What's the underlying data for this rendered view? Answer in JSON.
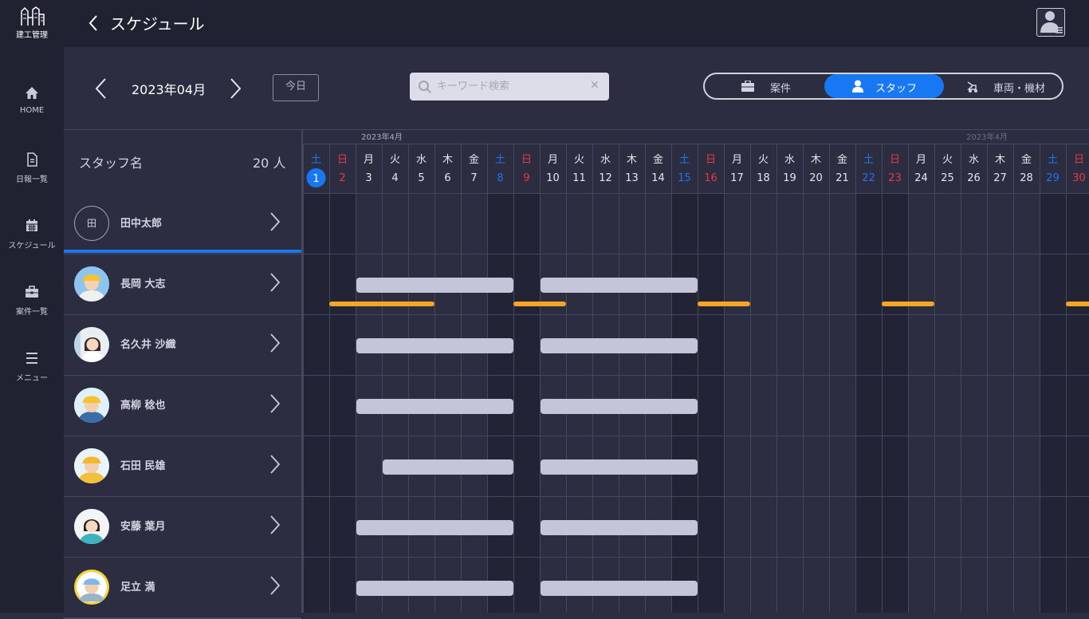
{
  "app": {
    "logo_text": "建工管理",
    "title": "スケジュール"
  },
  "sidebar": {
    "items": [
      {
        "label": "HOME",
        "icon": "home-icon"
      },
      {
        "label": "日報一覧",
        "icon": "document-icon"
      },
      {
        "label": "スケジュール",
        "icon": "calendar-icon"
      },
      {
        "label": "案件一覧",
        "icon": "briefcase-icon"
      },
      {
        "label": "メニュー",
        "icon": "menu-icon"
      }
    ]
  },
  "toolbar": {
    "month_label": "2023年04月",
    "today_label": "今日",
    "search_placeholder": "キーワード検索",
    "segments": [
      {
        "label": "案件",
        "icon": "briefcase-icon"
      },
      {
        "label": "スタッフ",
        "icon": "person-icon",
        "active": true
      },
      {
        "label": "車両・機材",
        "icon": "vehicle-icon"
      }
    ]
  },
  "staff": {
    "header_label": "スタッフ名",
    "count_label": "20 人",
    "members": [
      {
        "name": "田中太郎",
        "initial": "田"
      },
      {
        "name": "長岡 大志",
        "avatar": "worker-hardhat"
      },
      {
        "name": "名久井 沙織",
        "avatar": "office-woman"
      },
      {
        "name": "高柳 稔也",
        "avatar": "worker-hardhat"
      },
      {
        "name": "石田 民雄",
        "avatar": "worker-hardhat"
      },
      {
        "name": "安藤 葉月",
        "avatar": "woman"
      },
      {
        "name": "足立 満",
        "avatar": "worker-hardhat"
      }
    ]
  },
  "calendar": {
    "month_labels": [
      "2023年4月",
      "2023年4月"
    ],
    "today_day": 1,
    "days": [
      {
        "wd": "土",
        "d": "1"
      },
      {
        "wd": "日",
        "d": "2"
      },
      {
        "wd": "月",
        "d": "3"
      },
      {
        "wd": "火",
        "d": "4"
      },
      {
        "wd": "水",
        "d": "5"
      },
      {
        "wd": "木",
        "d": "6"
      },
      {
        "wd": "金",
        "d": "7"
      },
      {
        "wd": "土",
        "d": "8"
      },
      {
        "wd": "日",
        "d": "9"
      },
      {
        "wd": "月",
        "d": "10"
      },
      {
        "wd": "火",
        "d": "11"
      },
      {
        "wd": "水",
        "d": "12"
      },
      {
        "wd": "木",
        "d": "13"
      },
      {
        "wd": "金",
        "d": "14"
      },
      {
        "wd": "土",
        "d": "15"
      },
      {
        "wd": "日",
        "d": "16"
      },
      {
        "wd": "月",
        "d": "17"
      },
      {
        "wd": "火",
        "d": "18"
      },
      {
        "wd": "水",
        "d": "19"
      },
      {
        "wd": "木",
        "d": "20"
      },
      {
        "wd": "金",
        "d": "21"
      },
      {
        "wd": "土",
        "d": "22"
      },
      {
        "wd": "日",
        "d": "23"
      },
      {
        "wd": "月",
        "d": "24"
      },
      {
        "wd": "火",
        "d": "25"
      },
      {
        "wd": "水",
        "d": "26"
      },
      {
        "wd": "木",
        "d": "27"
      },
      {
        "wd": "金",
        "d": "28"
      },
      {
        "wd": "土",
        "d": "29"
      },
      {
        "wd": "日",
        "d": "30"
      }
    ],
    "colors": {
      "saturday": "#1877f2",
      "sunday": "#e53940",
      "weekday": "#e4e6f0",
      "bar": "#c4c5d8",
      "marker": "#f5a623",
      "today": "#1877f2"
    },
    "row_schedules": [
      [],
      [
        [
          3,
          8
        ],
        [
          10,
          15
        ]
      ],
      [
        [
          3,
          8
        ],
        [
          10,
          15
        ]
      ],
      [
        [
          3,
          8
        ],
        [
          10,
          15
        ]
      ],
      [
        [
          4,
          8
        ],
        [
          10,
          15
        ]
      ],
      [
        [
          3,
          8
        ],
        [
          10,
          15
        ]
      ],
      [
        [
          3,
          8
        ],
        [
          10,
          15
        ]
      ]
    ],
    "markers": [
      [
        2,
        5
      ],
      [
        9,
        10
      ],
      [
        16,
        17
      ],
      [
        23,
        24
      ],
      [
        30,
        30
      ]
    ]
  }
}
